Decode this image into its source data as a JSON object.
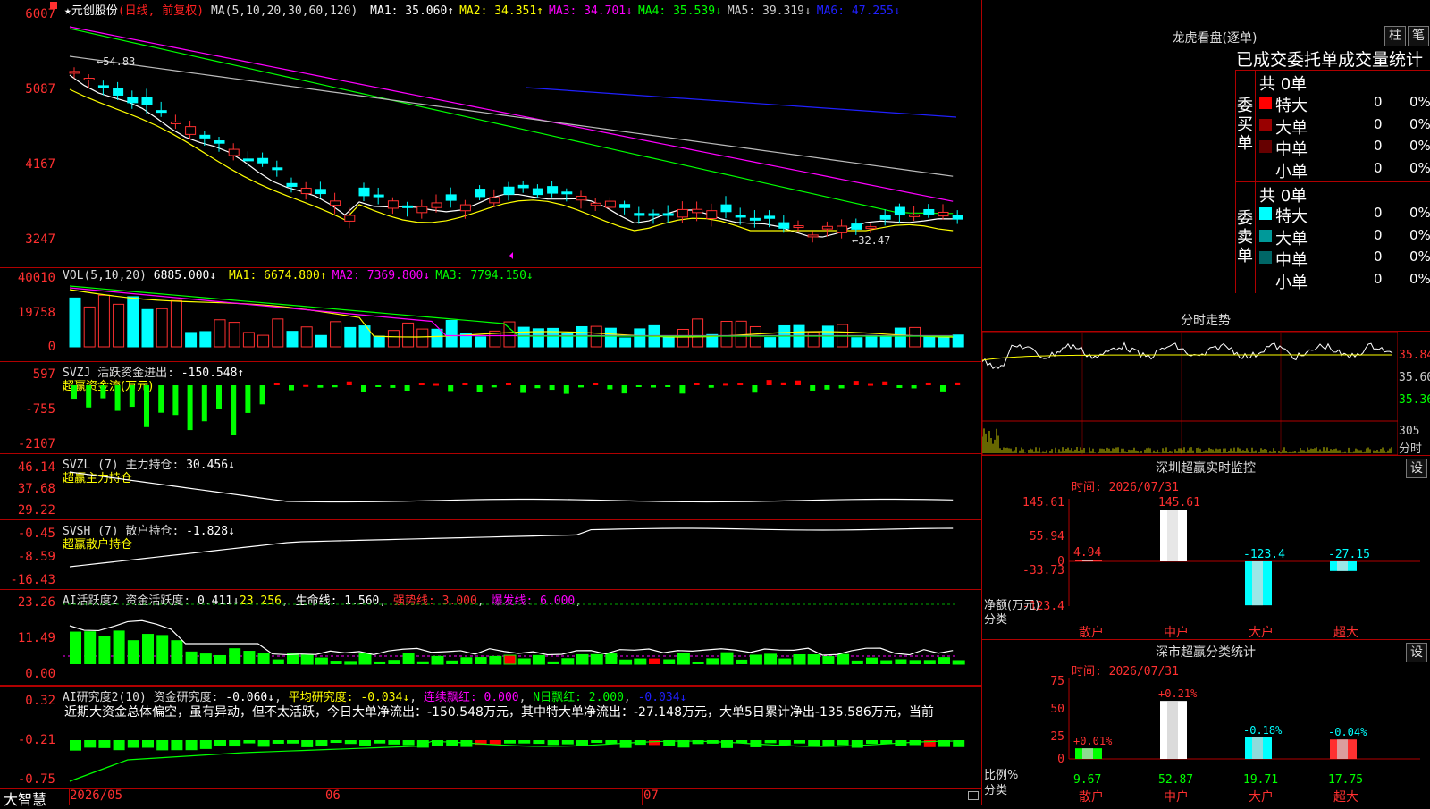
{
  "stock": {
    "name": "★元创股份",
    "mode": "(日线, 前复权)"
  },
  "kline": {
    "ma_label": "MA(5,10,20,30,60,120)",
    "ma_values": [
      {
        "name": "MA1:",
        "value": "35.060↑",
        "color": "#ffffff"
      },
      {
        "name": "MA2:",
        "value": "34.351↑",
        "color": "#ffff00"
      },
      {
        "name": "MA3:",
        "value": "34.701↓",
        "color": "#ff00ff"
      },
      {
        "name": "MA4:",
        "value": "35.539↓",
        "color": "#00ff00"
      },
      {
        "name": "MA5:",
        "value": "39.319↓",
        "color": "#cccccc"
      },
      {
        "name": "MA6:",
        "value": "47.255↓",
        "color": "#2020ff"
      }
    ],
    "y_ticks": [
      "6007",
      "5087",
      "4167",
      "3247"
    ],
    "high_mark": "54.83",
    "low_mark": "32.47"
  },
  "vol": {
    "label": "VOL(5,10,20)",
    "value": "6885.000↓",
    "ma": [
      {
        "name": "MA1:",
        "value": "6674.800↑",
        "color": "#ffff00"
      },
      {
        "name": "MA2:",
        "value": "7369.800↓",
        "color": "#ff00ff"
      },
      {
        "name": "MA3:",
        "value": "7794.150↓",
        "color": "#00ff00"
      }
    ],
    "y_ticks": [
      "40010",
      "19758",
      "0"
    ]
  },
  "svzj": {
    "label": "SVZJ",
    "title": "活跃资金进出:",
    "value": "-150.548↑",
    "sub": "超赢资金流(万元)",
    "y_ticks": [
      "597",
      "-755",
      "-2107"
    ]
  },
  "svzl": {
    "label": "SVZL (7)",
    "title": "主力持仓:",
    "value": "30.456↓",
    "sub": "超赢主力持仓",
    "y_ticks": [
      "46.14",
      "37.68",
      "29.22"
    ]
  },
  "svsh": {
    "label": "SVSH (7)",
    "title": "散户持仓:",
    "value": "-1.828↓",
    "sub": "超赢散户持仓",
    "y_ticks": [
      "-0.45",
      "-8.59",
      "-16.43"
    ]
  },
  "ai1": {
    "label": "AI活跃度2",
    "title": "资金活跃度:",
    "value": "0.411↓",
    "value2": "23.256",
    "life": "生命线: 1.560",
    "strong": "强势线: 3.000",
    "burst": "爆发线: 6.000",
    "y_ticks": [
      "23.26",
      "11.49",
      "0.00"
    ]
  },
  "ai2": {
    "label": "AI研究度2(10)",
    "title": "资金研究度:",
    "value": "-0.060↓",
    "avg": "平均研究度: -0.034↓",
    "red": "连续飘红: 0.000",
    "nred": "N日飘红: 2.000",
    "last": "-0.034↓",
    "comment": "近期大资金总体偏空，虽有异动，但不太活跃，今日大单净流出：-150.548万元，其中特大单净流出：-27.148万元，大单5日累计净出-135.586万元，当前",
    "y_ticks": [
      "0.32",
      "-0.21",
      "-0.75"
    ]
  },
  "dates": {
    "d1": "2026/05",
    "d2": "06",
    "d3": "07"
  },
  "brand": "大智慧",
  "longhu": {
    "title": "龙虎看盘(逐单)",
    "btn1": "柱",
    "btn2": "笔",
    "subtitle": "已成交委托单成交量统计",
    "buy_label": "委买单",
    "sell_label": "委卖单",
    "buy_total": "共 0单",
    "sell_total": "共 0单",
    "buy_rows": [
      {
        "name": "特大",
        "vol": "0",
        "pct": "0%",
        "color": "#ff0000"
      },
      {
        "name": "大单",
        "vol": "0",
        "pct": "0%",
        "color": "#990000"
      },
      {
        "name": "中单",
        "vol": "0",
        "pct": "0%",
        "color": "#660000"
      },
      {
        "name": "小单",
        "vol": "0",
        "pct": "0%",
        "color": "#000000"
      }
    ],
    "sell_rows": [
      {
        "name": "特大",
        "vol": "0",
        "pct": "0%",
        "color": "#00ffff"
      },
      {
        "name": "大单",
        "vol": "0",
        "pct": "0%",
        "color": "#009999"
      },
      {
        "name": "中单",
        "vol": "0",
        "pct": "0%",
        "color": "#006666"
      },
      {
        "name": "小单",
        "vol": "0",
        "pct": "0%",
        "color": "#000000"
      }
    ]
  },
  "intraday": {
    "title": "分时走势",
    "y_ticks": [
      "35.84",
      "35.60",
      "35.36"
    ],
    "vol_tick": "305",
    "vol_unit": "分时"
  },
  "sz_monitor": {
    "title": "深圳超赢实时监控",
    "btn": "设",
    "time": "时间: 2026/07/31",
    "y_ticks": [
      "145.61",
      "55.94",
      "0",
      "-33.73",
      "-123.4"
    ],
    "unit": "净额(万元)",
    "cat_label": "分类",
    "categories": [
      "散户",
      "中户",
      "大户",
      "超大"
    ],
    "values": [
      4.94,
      145.61,
      -123.4,
      -27.15
    ],
    "value_labels": [
      "4.94",
      "145.61",
      "-123.4",
      "-27.15"
    ]
  },
  "sz_stats": {
    "title": "深市超赢分类统计",
    "btn": "设",
    "time": "时间: 2026/07/31",
    "y_ticks": [
      "75",
      "50",
      "25",
      "0"
    ],
    "unit": "比例%",
    "cat_label": "分类",
    "categories": [
      "散户",
      "中户",
      "大户",
      "超大"
    ],
    "values": [
      9.67,
      52.87,
      19.71,
      17.75
    ],
    "value_labels": [
      "9.67",
      "52.87",
      "19.71",
      "17.75"
    ],
    "top_labels": [
      "+0.01%",
      "+0.21%",
      "-0.18%",
      "-0.04%"
    ]
  }
}
